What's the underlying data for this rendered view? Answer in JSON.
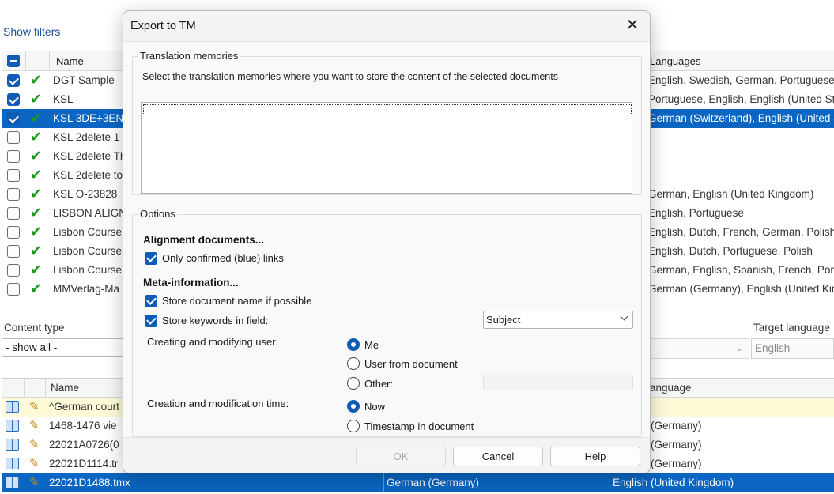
{
  "app": {
    "show_filters": "Show filters",
    "doc_grid": {
      "headers": {
        "name": "Name",
        "languages": "Languages"
      },
      "rows": [
        {
          "checked": true,
          "name": "DGT Sample",
          "languages": "English, Swedish, German, Portuguese,"
        },
        {
          "checked": true,
          "name": "KSL",
          "languages": "Portuguese, English, English (United Sta"
        },
        {
          "checked": true,
          "name": "KSL 3DE+3EN",
          "languages": "German (Switzerland), English (United S",
          "selected": true
        },
        {
          "checked": false,
          "name": "KSL 2delete 1",
          "languages": ""
        },
        {
          "checked": false,
          "name": "KSL 2delete TH",
          "languages": ""
        },
        {
          "checked": false,
          "name": "KSL 2delete to",
          "languages": ""
        },
        {
          "checked": false,
          "name": "KSL O-23828",
          "languages": "German, English (United Kingdom)"
        },
        {
          "checked": false,
          "name": "LISBON ALIGN",
          "languages": "English, Portuguese"
        },
        {
          "checked": false,
          "name": "Lisbon Course",
          "languages": "English, Dutch, French, German, Polish,"
        },
        {
          "checked": false,
          "name": "Lisbon Course",
          "languages": "English, Dutch, Portuguese, Polish"
        },
        {
          "checked": false,
          "name": "Lisbon Course",
          "languages": "German, English, Spanish, French, Portu"
        },
        {
          "checked": false,
          "name": "MMVerlag-Ma",
          "languages": "German (Germany), English (United Kin"
        }
      ]
    },
    "filters": {
      "content_type_label": "Content type",
      "content_type_value": "- show all -",
      "target_language_label": "Target language",
      "target_language_value": "English"
    },
    "entries_grid": {
      "headers": {
        "name": "Name",
        "language": "anguage"
      },
      "rows": [
        {
          "name": "^German court",
          "lang": "",
          "style": "yellow"
        },
        {
          "name": "1468-1476 vie",
          "lang": "(Germany)"
        },
        {
          "name": "22021A0726(0",
          "lang": "(Germany)"
        },
        {
          "name": "22021D1114.tr",
          "lang": "(Germany)"
        },
        {
          "name": "22021D1488.tmx",
          "source": "German (Germany)",
          "target": "English (United Kingdom)",
          "style": "selected"
        }
      ]
    }
  },
  "dialog": {
    "title": "Export to TM",
    "translation_memories": {
      "group_title": "Translation memories",
      "hint": "Select the translation memories where you want to store the content of the selected documents"
    },
    "options": {
      "group_title": "Options",
      "alignment_heading": "Alignment documents...",
      "only_confirmed": "Only confirmed (blue) links",
      "meta_heading": "Meta-information...",
      "store_doc_name": "Store document name if possible",
      "store_keywords": "Store keywords in field:",
      "keywords_field_value": "Subject",
      "user_label": "Creating and modifying user:",
      "user_options": [
        "Me",
        "User from document",
        "Other:"
      ],
      "user_selected": "Me",
      "time_label": "Creation and modification time:",
      "time_options": [
        "Now",
        "Timestamp in document"
      ],
      "time_selected": "Now"
    },
    "buttons": {
      "ok": "OK",
      "cancel": "Cancel",
      "help": "Help"
    }
  }
}
